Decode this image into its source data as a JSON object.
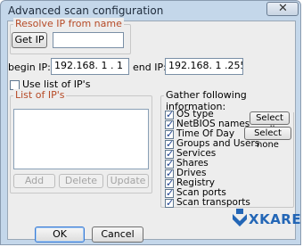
{
  "window": {
    "title": "Advanced scan configuration",
    "close_glyph": "✕"
  },
  "resolve_group": {
    "legend": "Resolve IP from name",
    "get_ip_label": "Get IP",
    "name_value": ""
  },
  "range": {
    "begin_label": "begin IP:",
    "begin_value": "192.168.  1  .  1",
    "end_label": "end IP:",
    "end_value": "192.168.  1  .255"
  },
  "use_list_label": "Use list of IP's",
  "list_group": {
    "legend": "List of IP's",
    "add_label": "Add",
    "delete_label": "Delete",
    "update_label": "Update"
  },
  "gather_group": {
    "legend": "Gather following information:",
    "items": [
      {
        "label": "OS type",
        "checked": true
      },
      {
        "label": "NetBIOS names",
        "checked": true
      },
      {
        "label": "Time Of Day",
        "checked": true
      },
      {
        "label": "Groups and Users",
        "checked": true
      },
      {
        "label": "Services",
        "checked": true
      },
      {
        "label": "Shares",
        "checked": true
      },
      {
        "label": "Drives",
        "checked": true
      },
      {
        "label": "Registry",
        "checked": true
      },
      {
        "label": "Scan ports",
        "checked": true
      },
      {
        "label": "Scan transports",
        "checked": true
      }
    ],
    "select_all_label": "Select all",
    "select_none_label": "Select none"
  },
  "buttons": {
    "ok_label": "OK",
    "cancel_label": "Cancel"
  },
  "logo": {
    "text": "XKARE",
    "color": "#2366b6"
  },
  "colors": {
    "legend_text": "#b64a26",
    "title_bar": "#c4d7ea"
  }
}
